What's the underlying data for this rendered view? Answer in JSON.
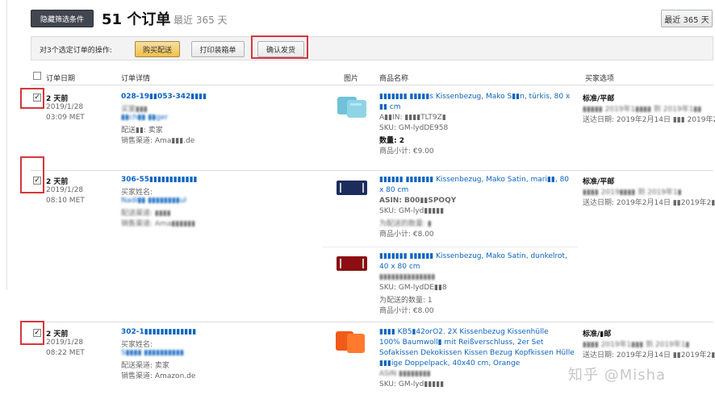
{
  "toolbar": {
    "hide_filters_label": "隐藏筛选条件",
    "order_count": "51 个订单",
    "range_label": "最近 365 天",
    "range_button": "最近 365 天"
  },
  "actions": {
    "label": "对3个选定订单的操作:",
    "buy_shipping": "购买配送",
    "print_packing": "打印装箱单",
    "confirm_ship": "确认发货"
  },
  "headers": {
    "date": "订单日期",
    "details": "订单详情",
    "image": "图片",
    "product": "商品名称",
    "buyer_options": "买家选项"
  },
  "orders": [
    {
      "date_rel": "2 天前",
      "date": "2019/1/28",
      "time": "03:09 MET",
      "order_id": "028-19▮▮053-342▮▮▮▮",
      "buyer_label": "买家▮▮▮",
      "buyer_name": "▮▮ch▮▮ ▮▮ger",
      "ship_channel": "配送▮▮: 卖家",
      "sales_channel": "销售渠道: Ama▮▮▮.de",
      "items": [
        {
          "title_1": "▮▮▮▮▮▮▮ ▮▮▮▮▮s Kissenbezug, Mako S▮▮n, türkis, 80 x",
          "title_2": "▮▮ cm",
          "asin": "A▮▮IN: ▮▮▮▮TLT9Z▮",
          "sku": "SKU: GM-lydDE958",
          "qty": "数量: 2",
          "subtotal": "商品小计: €9.00"
        }
      ],
      "shipping_method": "标准/平邮",
      "ship_by": "▮▮▮▮▮ 2019年1▮▮▮▮ 到 2019年1▮▮",
      "deliver_by": "送达日期: 2019年2月14日 ▮▮▮ 2019年2▮"
    },
    {
      "date_rel": "2 天前",
      "date": "2019/1/28",
      "time": "08:10 MET",
      "order_id": "306-55▮▮▮▮▮▮▮▮▮▮▮▮",
      "buyer_label": "买家姓名:",
      "buyer_name": "Nadi▮▮ ▮▮▮▮▮▮▮▮ul",
      "ship_channel": "配送渠道: ▮▮▮▮",
      "sales_channel": "销售渠道: Ama▮▮▮▮▮▮",
      "items": [
        {
          "title_1": "▮▮▮▮▮▮ ▮▮▮▮▮▮▮ Kissenbezug, Mako Satin, mari▮▮, 80",
          "title_2": "x 80 cm",
          "asin": "ASIN: B00▮▮SPOQY",
          "sku": "SKU: GM-lyd▮▮▮▮▮",
          "qty": "为配送的数量: ▮",
          "subtotal": "商品小计: €8.00"
        },
        {
          "title_1": "▮▮▮▮▮▮▮ ▮▮▮▮▮▮ Kissenbezug, Mako Satin, dunkelrot,",
          "title_2": "40 x 80 cm",
          "asin": "▮▮▮▮▮▮▮▮▮▮▮▮▮▮",
          "sku": "SKU: GM-lydDE▮▮8",
          "qty": "为配送的数量: 1",
          "subtotal": "商品小计: €8.00"
        }
      ],
      "shipping_method": "标准/平邮",
      "ship_by": "▮▮▮▮ 2019▮▮▮▮ 到 2019年1▮",
      "deliver_by": "送达日期: 2019年2月14日 ▮▮2019年2▮"
    },
    {
      "date_rel": "2 天前",
      "date": "2019/1/28",
      "time": "08:22 MET",
      "order_id": "302-1▮▮▮▮▮▮▮▮▮▮▮▮▮",
      "buyer_label": "买家姓名:",
      "buyer_name": "S▮▮▮▮ ▮▮▮▮▮▮▮▮▮▮",
      "ship_channel": "配送渠道: 卖家",
      "sales_channel": "销售渠道: Amazon.de",
      "items": [
        {
          "title_1": "▮▮▮▮ KB5▮42orO2. 2X Kissenbezug Kissenhülle",
          "title_2": "100% Baumwoll▮ mit Reißverschluss, 2er Set",
          "title_3": "Sofakissen Dekokissen Kissen Bezug Kopfkissen Hülle",
          "title_4": "▮▮▮ige Doppelpack, 40x40 cm, Orange",
          "asin": "ASIN ▮▮▮▮▮▮▮▮",
          "sku": "SKU: GM-lyd▮▮▮▮▮"
        }
      ],
      "shipping_method": "标准/▮邮",
      "ship_by": "▮▮▮▮ 2019年1▮▮▮ 到 2019年1▮",
      "deliver_by": "送达日期: 2019年2月14日 ▮▮2019年2▮"
    }
  ],
  "watermark": "知乎 @Misha",
  "colors": {
    "action_yellow": "#f0c14b",
    "link_blue": "#0b64c0",
    "highlight_red": "#d6373b",
    "dark_button": "#42464f"
  }
}
